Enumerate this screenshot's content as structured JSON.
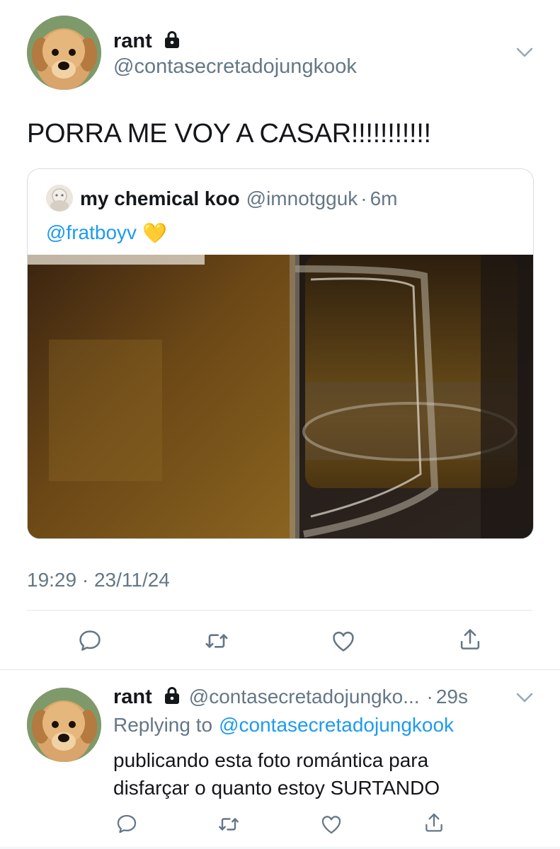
{
  "main_tweet": {
    "author": {
      "name": "rant",
      "handle": "@contasecretadojungkook",
      "avatar_icon": "puppy-avatar",
      "protected_icon": "lock-icon"
    },
    "text": "PORRA ME VOY A CASAR!!!!!!!!!!!",
    "quoted": {
      "name": "my chemical koo",
      "handle": "@imnotgguk",
      "separator": "·",
      "time": "6m",
      "mention": "@fratboyv",
      "emoji": "💛",
      "image_icon": "beer-mugs-photo"
    },
    "timestamp": "19:29 · 23/11/24",
    "actions": [
      "reply-icon",
      "retweet-icon",
      "like-icon",
      "share-icon"
    ]
  },
  "reply_tweet": {
    "author": {
      "name": "rant",
      "handle": "@contasecretadojungko...",
      "avatar_icon": "puppy-avatar",
      "protected_icon": "lock-icon"
    },
    "separator": "·",
    "time": "29s",
    "replying_label": "Replying to",
    "replying_handle": "@contasecretadojungkook",
    "text_line1": "publicando esta foto romántica para",
    "text_line2": "disfarçar o quanto estoy SURTANDO",
    "actions": [
      "reply-icon",
      "retweet-icon",
      "like-icon",
      "share-icon"
    ]
  },
  "colors": {
    "accent": "#1d9bf0",
    "muted": "#657786",
    "text": "#14171a",
    "border": "#e1e8ed"
  }
}
